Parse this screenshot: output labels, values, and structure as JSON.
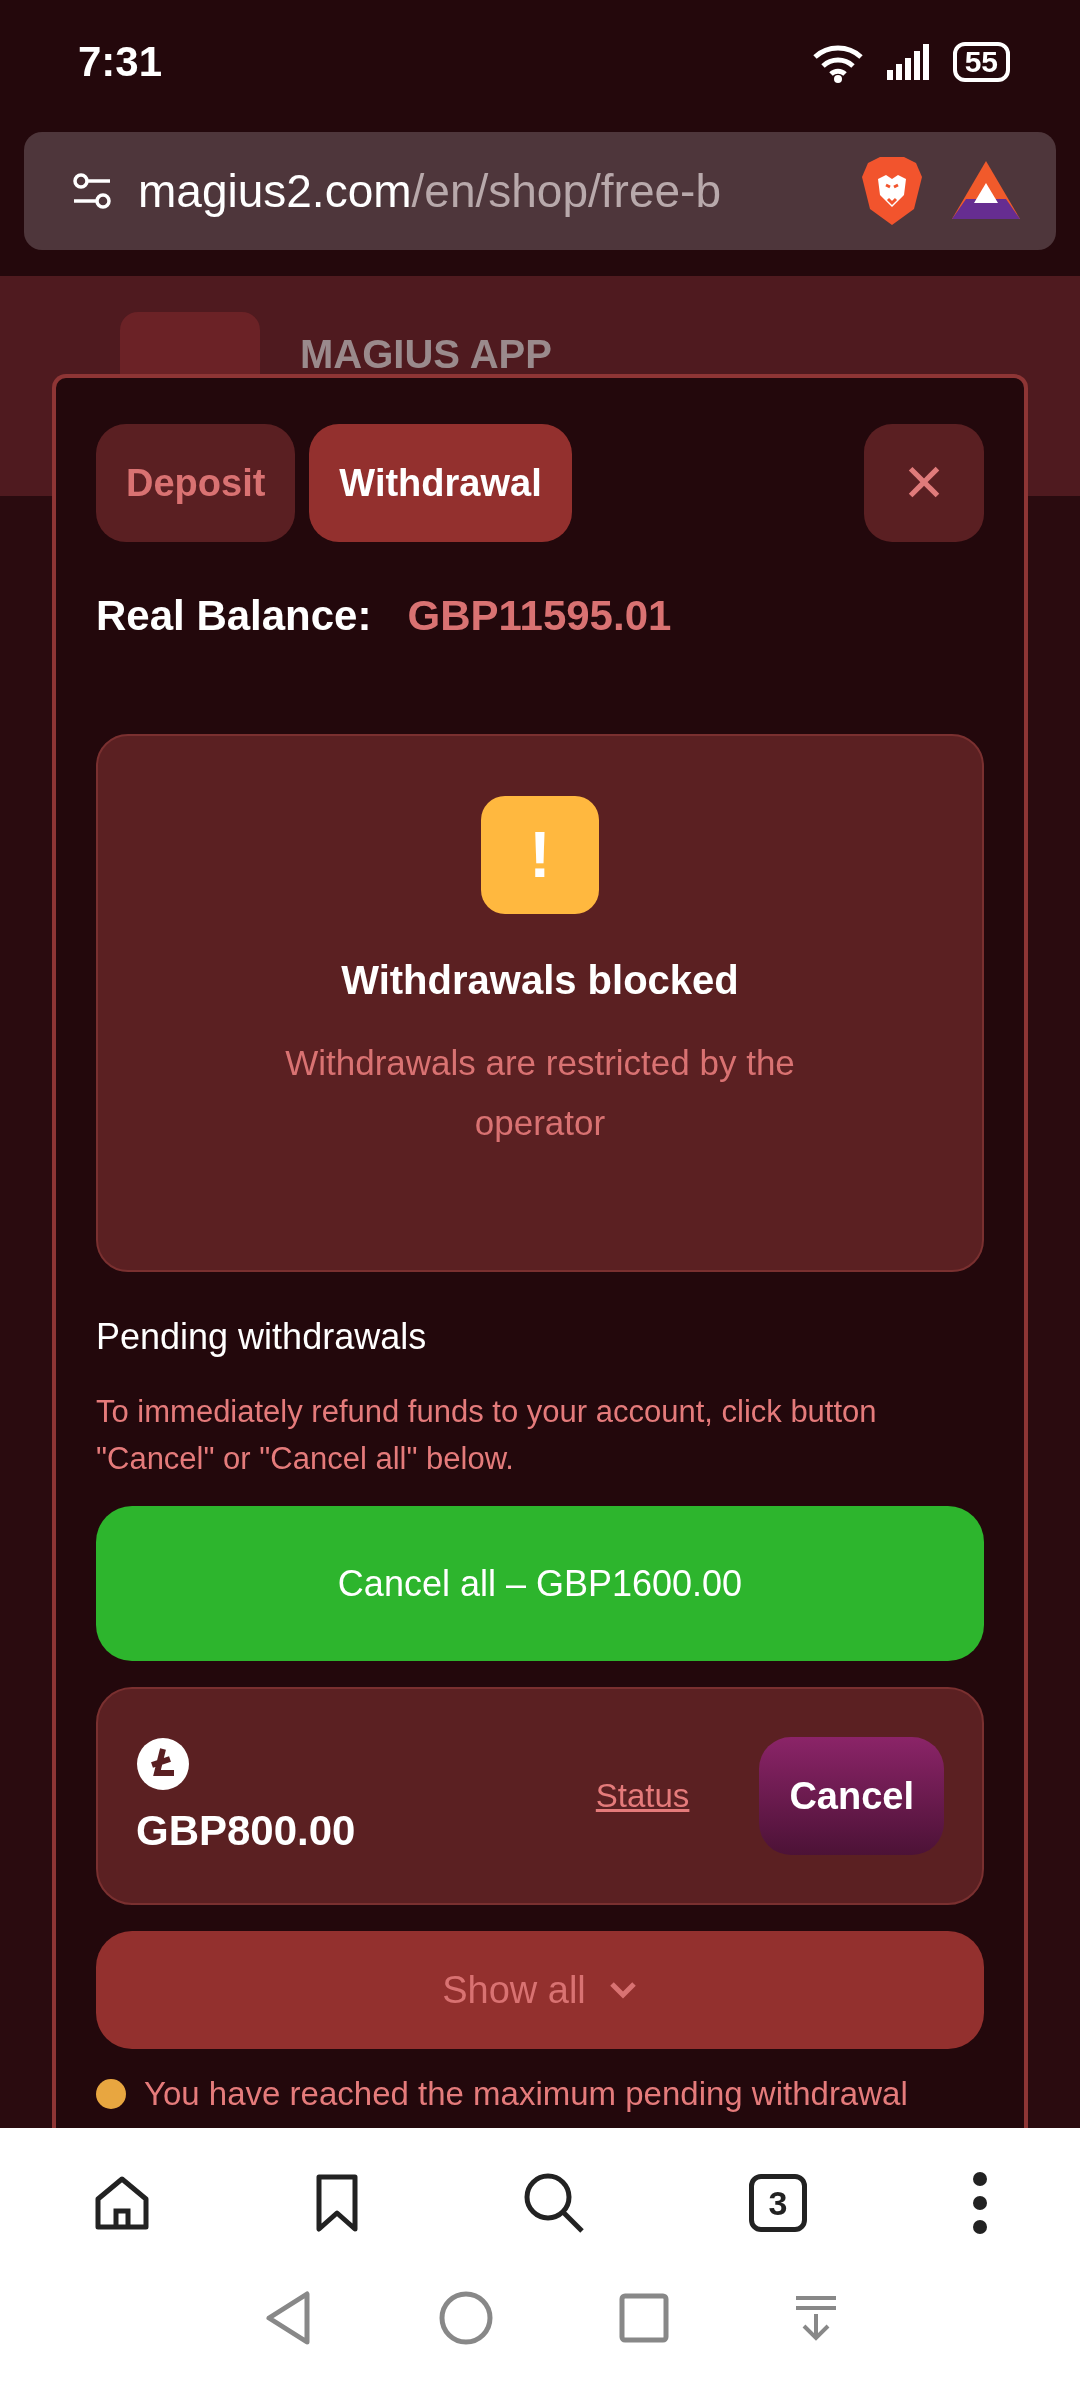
{
  "status_bar": {
    "time": "7:31",
    "battery": "55"
  },
  "address_bar": {
    "domain": "magius2.com",
    "path": "/en/shop/free-b"
  },
  "background_page": {
    "app_title": "MAGIUS APP"
  },
  "modal": {
    "tabs": [
      {
        "label": "Deposit",
        "selected": false
      },
      {
        "label": "Withdrawal",
        "selected": true
      }
    ],
    "close": "✕",
    "balance": {
      "label": "Real Balance:",
      "value": "GBP11595.01"
    },
    "notice": {
      "icon": "!",
      "title": "Withdrawals blocked",
      "message": "Withdrawals are restricted by the operator"
    },
    "pending": {
      "title": "Pending withdrawals",
      "note": "To immediately refund funds to your account, click button \"Cancel\" or \"Cancel all\" below.",
      "cancel_all": "Cancel all – GBP1600.00",
      "items": [
        {
          "amount": "GBP800.00",
          "status_link": "Status",
          "cancel": "Cancel"
        }
      ],
      "show_all": "Show all"
    },
    "warning": "You have reached the maximum pending withdrawal"
  },
  "bottom_nav": {
    "tabs_count": "3"
  }
}
